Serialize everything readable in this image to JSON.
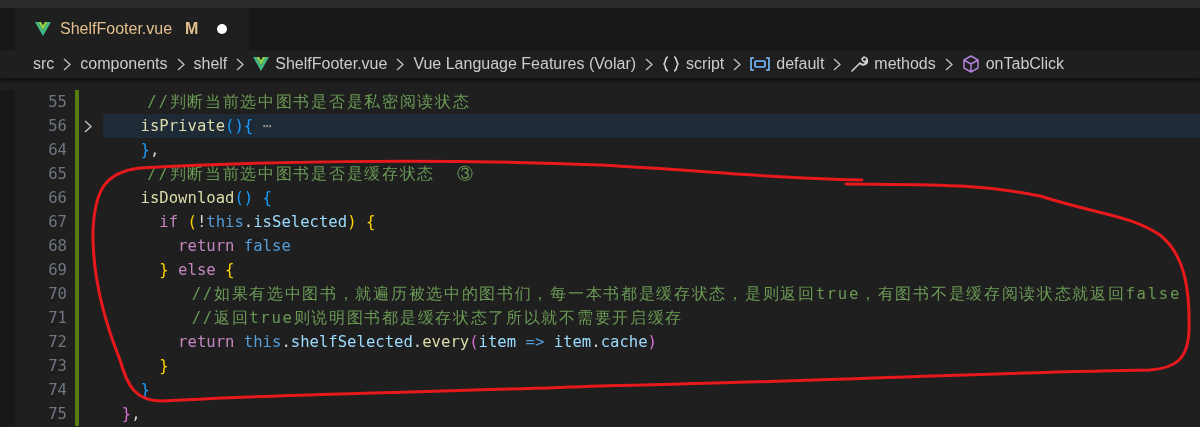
{
  "tab": {
    "label": "ShelfFooter.vue",
    "badge": "M",
    "dirty": true,
    "selected": true
  },
  "breadcrumbs": [
    {
      "kind": "plain",
      "text": "src"
    },
    {
      "kind": "plain",
      "text": "components"
    },
    {
      "kind": "plain",
      "text": "shelf"
    },
    {
      "kind": "vue",
      "text": "ShelfFooter.vue"
    },
    {
      "kind": "plain",
      "text": "Vue Language Features (Volar)"
    },
    {
      "kind": "braces",
      "text": "script"
    },
    {
      "kind": "module",
      "text": "default"
    },
    {
      "kind": "wrench",
      "text": "methods"
    },
    {
      "kind": "cube",
      "text": "onTabClick"
    }
  ],
  "lines": [
    {
      "number": "55",
      "folded": false,
      "highlighted": false,
      "tokens": [
        {
          "kind": "comment",
          "text": "    //判断当前选中图书是否是私密阅读状态"
        }
      ]
    },
    {
      "number": "56",
      "folded": true,
      "highlighted": true,
      "tokens": [
        {
          "kind": "fn",
          "text": "    isPrivate"
        },
        {
          "kind": "b3",
          "text": "(){"
        },
        {
          "kind": "fold",
          "text": " ⋯"
        }
      ]
    },
    {
      "number": "64",
      "folded": false,
      "highlighted": false,
      "tokens": [
        {
          "kind": "b3",
          "text": "    }"
        },
        {
          "kind": "plain",
          "text": ","
        }
      ]
    },
    {
      "number": "65",
      "folded": false,
      "highlighted": false,
      "tokens": [
        {
          "kind": "comment",
          "text": "    //判断当前选中图书是否是缓存状态  ③"
        }
      ]
    },
    {
      "number": "66",
      "folded": false,
      "highlighted": false,
      "tokens": [
        {
          "kind": "fn",
          "text": "    isDownload"
        },
        {
          "kind": "b3",
          "text": "() {"
        }
      ]
    },
    {
      "number": "67",
      "folded": false,
      "highlighted": false,
      "tokens": [
        {
          "kind": "keyword",
          "text": "      if "
        },
        {
          "kind": "b1",
          "text": "("
        },
        {
          "kind": "plain",
          "text": "!"
        },
        {
          "kind": "const",
          "text": "this"
        },
        {
          "kind": "plain",
          "text": "."
        },
        {
          "kind": "var",
          "text": "isSelected"
        },
        {
          "kind": "b1",
          "text": ") {"
        }
      ]
    },
    {
      "number": "68",
      "folded": false,
      "highlighted": false,
      "tokens": [
        {
          "kind": "keyword",
          "text": "        return "
        },
        {
          "kind": "const",
          "text": "false"
        }
      ]
    },
    {
      "number": "69",
      "folded": false,
      "highlighted": false,
      "tokens": [
        {
          "kind": "b1",
          "text": "      } "
        },
        {
          "kind": "keyword",
          "text": "else "
        },
        {
          "kind": "b1",
          "text": "{"
        }
      ]
    },
    {
      "number": "70",
      "folded": false,
      "highlighted": false,
      "tokens": [
        {
          "kind": "comment",
          "text": "        //如果有选中图书，就遍历被选中的图书们，每一本书都是缓存状态，是则返回true，有图书不是缓存阅读状态就返回false"
        }
      ]
    },
    {
      "number": "71",
      "folded": false,
      "highlighted": false,
      "tokens": [
        {
          "kind": "comment",
          "text": "        //返回true则说明图书都是缓存状态了所以就不需要开启缓存"
        }
      ]
    },
    {
      "number": "72",
      "folded": false,
      "highlighted": false,
      "tokens": [
        {
          "kind": "keyword",
          "text": "        return "
        },
        {
          "kind": "const",
          "text": "this"
        },
        {
          "kind": "plain",
          "text": "."
        },
        {
          "kind": "var",
          "text": "shelfSelected"
        },
        {
          "kind": "plain",
          "text": "."
        },
        {
          "kind": "fn",
          "text": "every"
        },
        {
          "kind": "b2",
          "text": "("
        },
        {
          "kind": "var",
          "text": "item "
        },
        {
          "kind": "const",
          "text": "=> "
        },
        {
          "kind": "var",
          "text": "item"
        },
        {
          "kind": "plain",
          "text": "."
        },
        {
          "kind": "var",
          "text": "cache"
        },
        {
          "kind": "b2",
          "text": ")"
        }
      ]
    },
    {
      "number": "73",
      "folded": false,
      "highlighted": false,
      "tokens": [
        {
          "kind": "b1",
          "text": "      }"
        }
      ]
    },
    {
      "number": "74",
      "folded": false,
      "highlighted": false,
      "tokens": [
        {
          "kind": "b3",
          "text": "    }"
        }
      ]
    },
    {
      "number": "75",
      "folded": false,
      "highlighted": false,
      "tokens": [
        {
          "kind": "b2",
          "text": "  }"
        },
        {
          "kind": "plain",
          "text": ","
        }
      ]
    }
  ]
}
